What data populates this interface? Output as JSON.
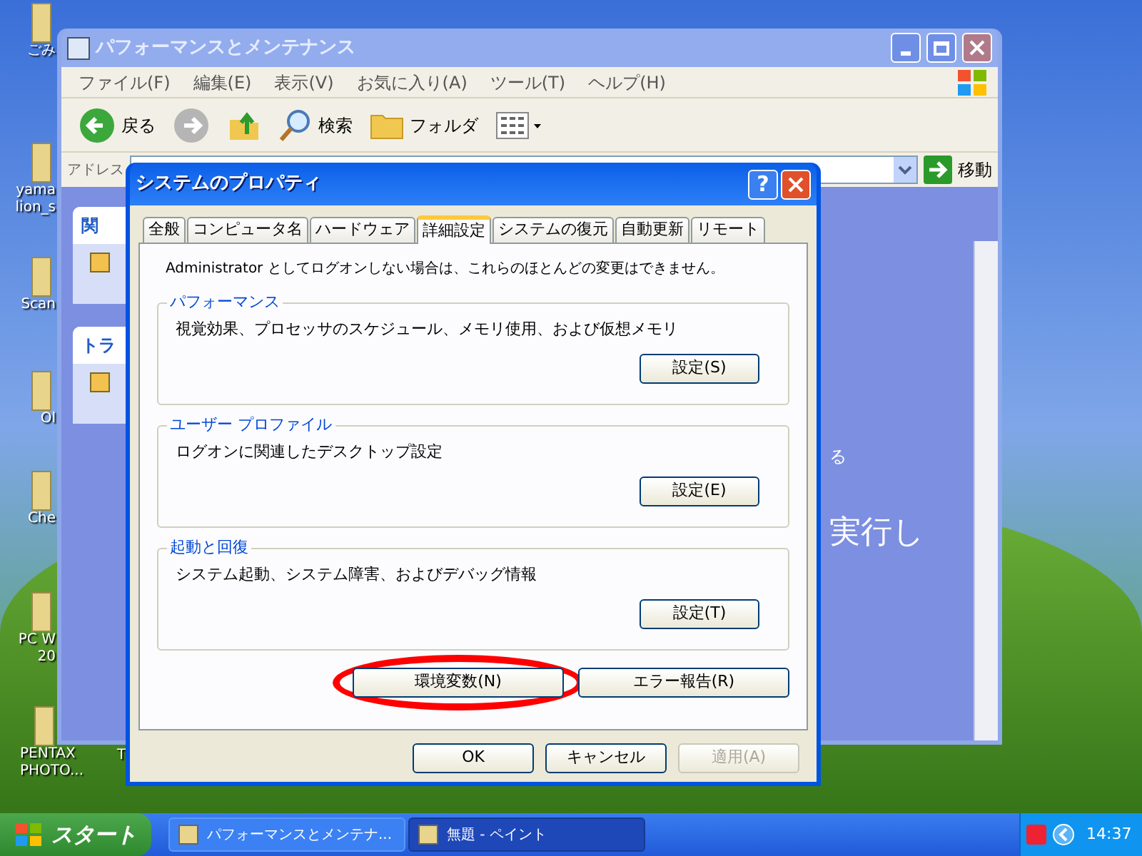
{
  "desktop": {
    "icons": [
      {
        "label": "ごみ"
      },
      {
        "label": "yama lion_s"
      },
      {
        "label": "Scan"
      },
      {
        "label": "Ol"
      },
      {
        "label": "Che"
      },
      {
        "label": "PC W 20"
      },
      {
        "label": "PENTAX PHOTO..."
      },
      {
        "label": "T"
      }
    ]
  },
  "explorer": {
    "title": "パフォーマンスとメンテナンス",
    "active": false,
    "menu": [
      "ファイル(F)",
      "編集(E)",
      "表示(V)",
      "お気に入り(A)",
      "ツール(T)",
      "ヘルプ(H)"
    ],
    "toolbar": [
      {
        "kind": "back",
        "label": "戻る"
      },
      {
        "kind": "forward"
      },
      {
        "kind": "up"
      },
      {
        "kind": "search",
        "label": "検索"
      },
      {
        "kind": "folders",
        "label": "フォルダ"
      },
      {
        "kind": "views"
      }
    ],
    "address_label": "アドレス",
    "go_button": "移動",
    "side_panels": [
      {
        "title": "関"
      },
      {
        "title": "トラ"
      }
    ],
    "content_texts": [
      "る",
      "実行し"
    ]
  },
  "dialog": {
    "title": "システムのプロパティ",
    "help_button": "?",
    "tabs": [
      {
        "label": "全般",
        "selected": false
      },
      {
        "label": "コンピュータ名",
        "selected": false
      },
      {
        "label": "ハードウェア",
        "selected": false
      },
      {
        "label": "詳細設定",
        "selected": true
      },
      {
        "label": "システムの復元",
        "selected": false
      },
      {
        "label": "自動更新",
        "selected": false
      },
      {
        "label": "リモート",
        "selected": false
      }
    ],
    "notice": "Administrator としてログオンしない場合は、これらのほとんどの変更はできません。",
    "groups": [
      {
        "title": "パフォーマンス",
        "description": "視覚効果、プロセッサのスケジュール、メモリ使用、および仮想メモリ",
        "button": "設定(S)"
      },
      {
        "title": "ユーザー プロファイル",
        "description": "ログオンに関連したデスクトップ設定",
        "button": "設定(E)"
      },
      {
        "title": "起動と回復",
        "description": "システム起動、システム障害、およびデバッグ情報",
        "button": "設定(T)"
      }
    ],
    "extra_buttons": [
      {
        "label": "環境変数(N)",
        "circled": true
      },
      {
        "label": "エラー報告(R)",
        "circled": false
      }
    ],
    "footer_buttons": [
      {
        "label": "OK",
        "disabled": false
      },
      {
        "label": "キャンセル",
        "disabled": false
      },
      {
        "label": "適用(A)",
        "disabled": true
      }
    ]
  },
  "taskbar": {
    "start": "スタート",
    "tasks": [
      {
        "label": "パフォーマンスとメンテナ...",
        "selected": false
      },
      {
        "label": "無題 - ペイント",
        "selected": true
      }
    ],
    "clock": "14:37"
  }
}
